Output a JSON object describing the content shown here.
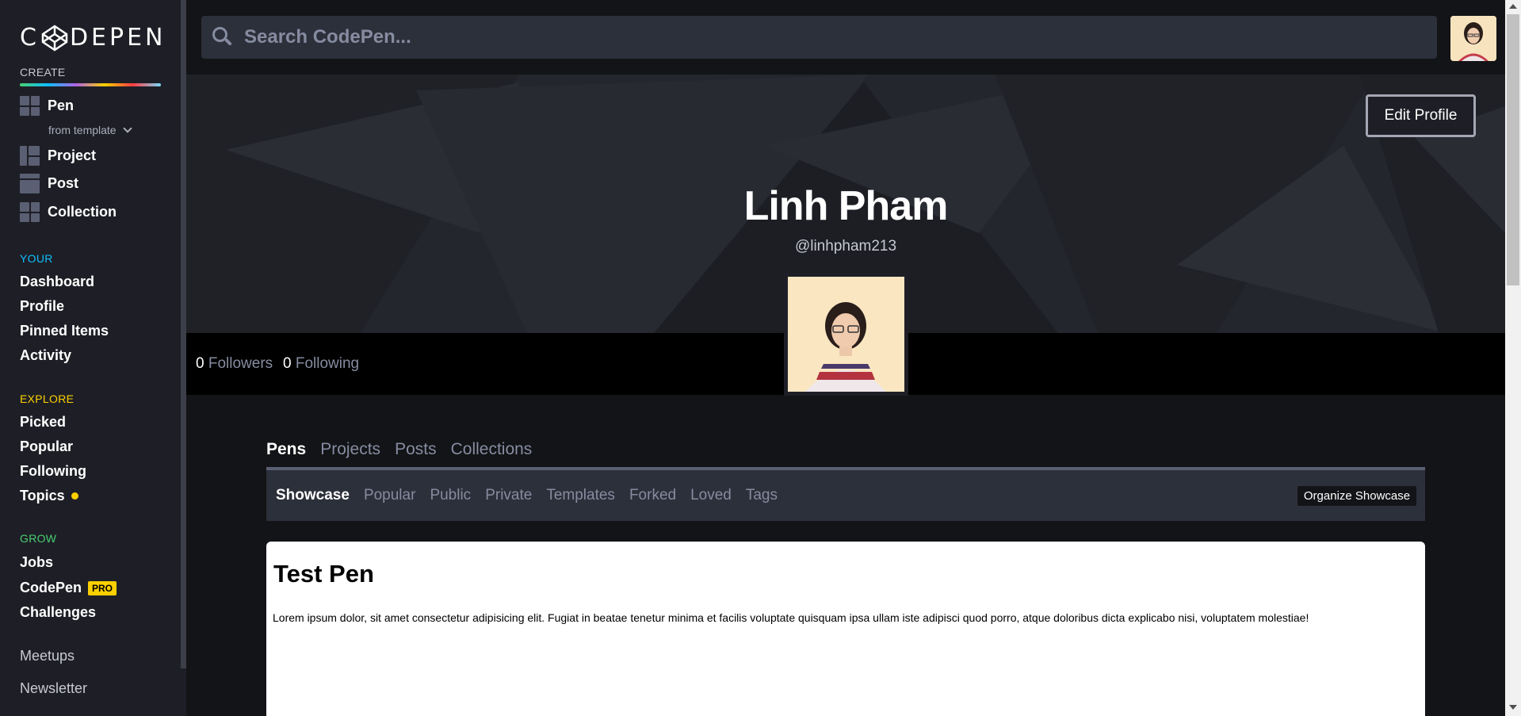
{
  "sidebar": {
    "logo_text_left": "C",
    "logo_text_right": "DEPEN",
    "create_label": "CREATE",
    "create_items": [
      {
        "label": "Pen",
        "icon": "pen-grid-icon"
      },
      {
        "label": "Project",
        "icon": "project-icon"
      },
      {
        "label": "Post",
        "icon": "post-icon"
      },
      {
        "label": "Collection",
        "icon": "collection-icon"
      }
    ],
    "from_template": "from template",
    "your_label": "YOUR",
    "your_items": [
      "Dashboard",
      "Profile",
      "Pinned Items",
      "Activity"
    ],
    "explore_label": "EXPLORE",
    "explore_items": [
      "Picked",
      "Popular",
      "Following",
      "Topics"
    ],
    "grow_label": "GROW",
    "grow_items": [
      "Jobs",
      "CodePen",
      "Challenges"
    ],
    "pro_badge": "PRO",
    "other_items": [
      "Meetups",
      "Newsletter"
    ]
  },
  "search": {
    "placeholder": "Search CodePen..."
  },
  "profile": {
    "name": "Linh Pham",
    "handle": "@linhpham213",
    "edit_button": "Edit Profile",
    "followers_count": "0",
    "followers_label": "Followers",
    "following_count": "0",
    "following_label": "Following"
  },
  "tabs": {
    "main": [
      "Pens",
      "Projects",
      "Posts",
      "Collections"
    ],
    "sub": [
      "Showcase",
      "Popular",
      "Public",
      "Private",
      "Templates",
      "Forked",
      "Loved",
      "Tags"
    ],
    "organize_button": "Organize Showcase"
  },
  "pen": {
    "title": "Test Pen",
    "body": "Lorem ipsum dolor, sit amet consectetur adipisicing elit. Fugiat in beatae tenetur minima et facilis voluptate quisquam ipsa ullam iste adipisci quod porro, atque doloribus dicta explicabo nisi, voluptatem molestiae!"
  },
  "colors": {
    "create_accent": "#47cf73",
    "your_accent": "#0ebeff",
    "explore_accent": "#fcd000",
    "grow_accent": "#47cf73"
  }
}
